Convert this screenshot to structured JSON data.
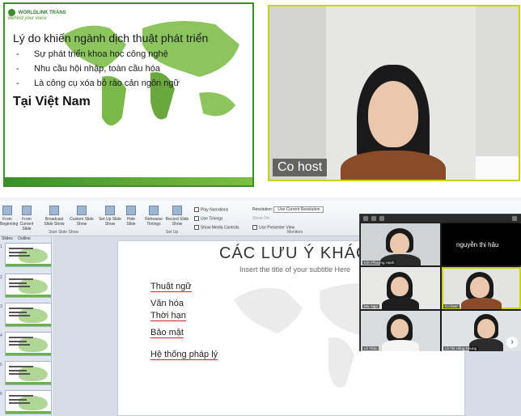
{
  "slide1": {
    "logo_text": "WORLDLINK TRANS",
    "logo_tagline": "Behind your voice",
    "title": "Lý do khiến ngành dịch thuật phát triển",
    "bullets": [
      {
        "dash": "-",
        "text": "Sự phát triển khoa học công nghệ"
      },
      {
        "dash": "-",
        "text": "Nhu cầu hội nhập, toàn cầu hóa"
      },
      {
        "dash": "-",
        "text": "Là công cụ xóa bỏ rào cản ngôn ngữ"
      }
    ],
    "heading": "Tại Việt Nam"
  },
  "video": {
    "host_label": "Co host"
  },
  "ribbon": {
    "buttons": [
      {
        "label": "From Beginning"
      },
      {
        "label": "From Current Slide"
      },
      {
        "label": "Broadcast Slide Show"
      },
      {
        "label": "Custom Slide Show"
      },
      {
        "label": "Set Up Slide Show"
      },
      {
        "label": "Hide Slide"
      },
      {
        "label": "Rehearse Timings"
      },
      {
        "label": "Record Slide Show"
      }
    ],
    "groups": [
      "Start Slide Show",
      "Set Up",
      "Monitors"
    ],
    "checks": [
      "Play Narrations",
      "Use Timings",
      "Show Media Controls"
    ],
    "monitor": {
      "resolution_label": "Resolution:",
      "resolution_value": "Use Current Resolution",
      "show_on": "Show On:",
      "presenter_view": "Use Presenter View"
    }
  },
  "thumbs": {
    "tabs": [
      "Slides",
      "Outline"
    ],
    "numbers": [
      "1",
      "2",
      "3",
      "4",
      "5",
      "6",
      "7"
    ]
  },
  "main_slide": {
    "title": "CÁC LƯU Ý KHÁC",
    "subtitle": "Insert the title of your subtitle Here",
    "items": [
      "Thuật ngữ",
      "Văn hóa",
      "Thời hạn",
      "Bảo mật",
      "Hệ thống pháp lý"
    ]
  },
  "gallery": {
    "participants": [
      {
        "name": "Kim Phượng Hạnh",
        "label": "nguyễn thị hậu"
      },
      {
        "name": "Ms. Nga",
        "label": ""
      },
      {
        "name": "Co host",
        "label": ""
      },
      {
        "name": "Lê Thảo",
        "label": ""
      },
      {
        "name": "Lê Thị Hồng Nhung",
        "label": ""
      }
    ],
    "next_arrow": "›"
  },
  "colors": {
    "accent_green": "#3a8f2a",
    "video_border": "#c8d400",
    "underline": "#cc2a2a"
  }
}
